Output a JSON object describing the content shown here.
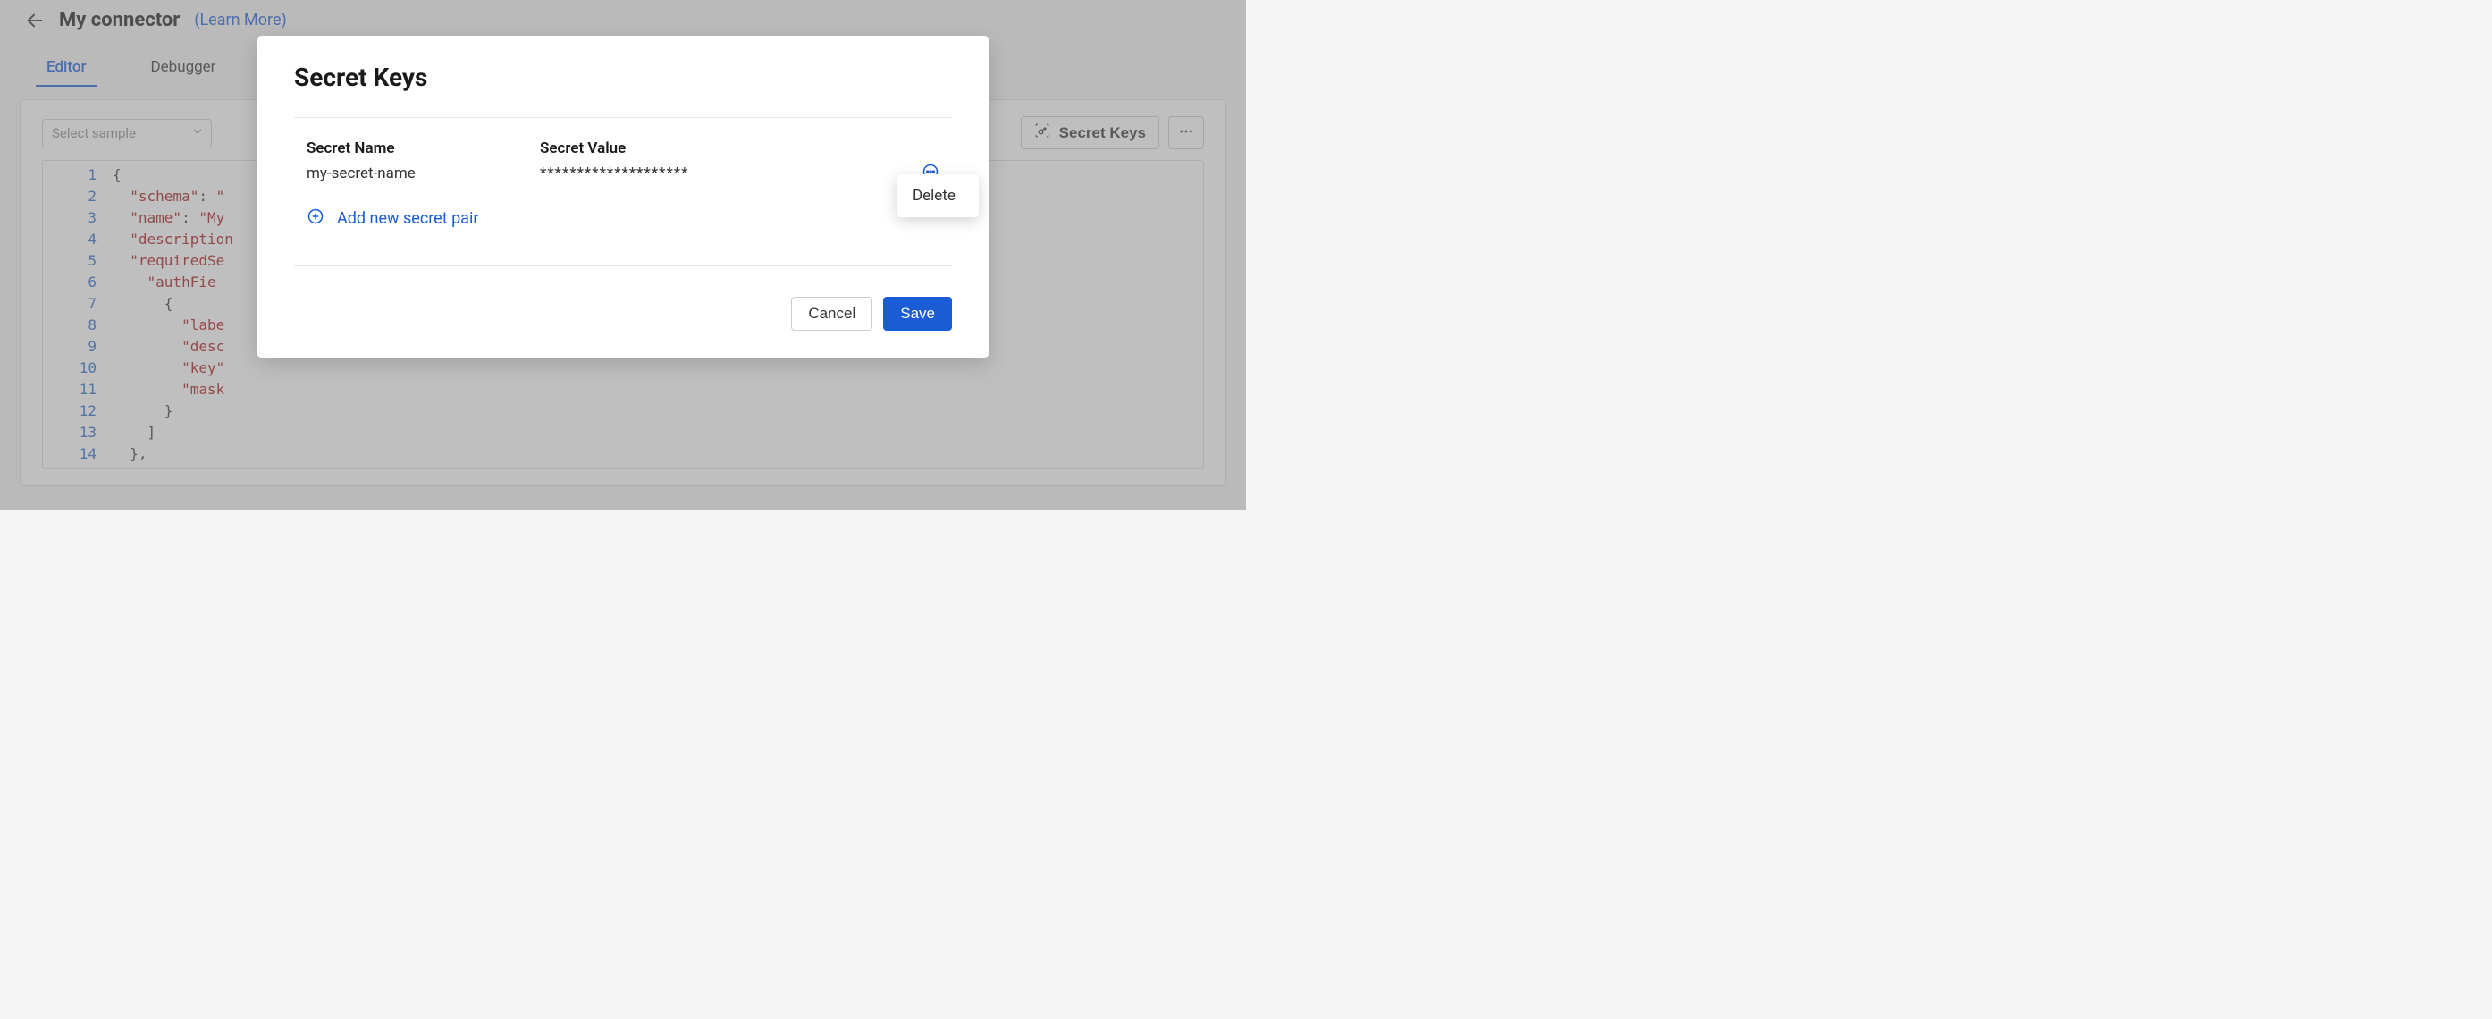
{
  "header": {
    "title": "My connector",
    "learn_more": "(Learn More)"
  },
  "tabs": {
    "editor": "Editor",
    "debugger": "Debugger"
  },
  "toolbar": {
    "select_sample_placeholder": "Select sample",
    "secret_keys_label": "Secret Keys"
  },
  "code": {
    "lines": [
      "1",
      "2",
      "3",
      "4",
      "5",
      "6",
      "7",
      "8",
      "9",
      "10",
      "11",
      "12",
      "13",
      "14"
    ],
    "content": [
      "{",
      "  \"schema\": \"",
      "  \"name\": \"My",
      "  \"description",
      "  \"requiredSe",
      "    \"authFie",
      "      {",
      "        \"labe",
      "        \"desc",
      "        \"key\"",
      "        \"mask",
      "      }",
      "    ]",
      "  },"
    ]
  },
  "modal": {
    "title": "Secret Keys",
    "col_name": "Secret Name",
    "col_value": "Secret Value",
    "secrets": [
      {
        "name": "my-secret-name",
        "value": "********************"
      }
    ],
    "add_label": "Add new secret pair",
    "cancel": "Cancel",
    "save": "Save"
  },
  "context_menu": {
    "delete": "Delete"
  }
}
